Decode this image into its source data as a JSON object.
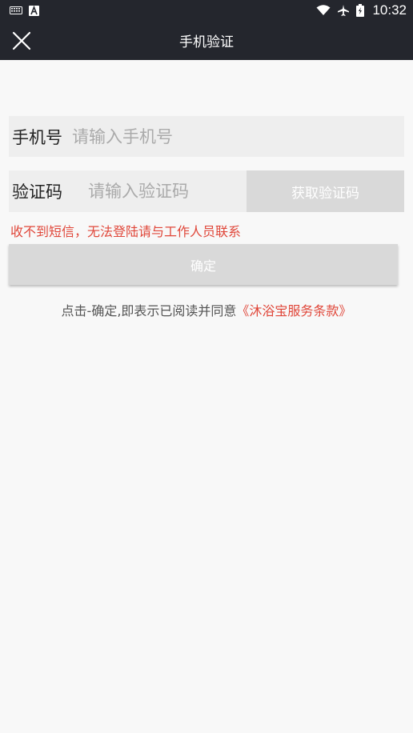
{
  "status_bar": {
    "time": "10:32",
    "left_icons": [
      "keyboard-icon",
      "a-badge-icon"
    ],
    "right_icons": [
      "wifi-icon",
      "airplane-icon",
      "battery-icon"
    ]
  },
  "header": {
    "title": "手机验证",
    "close_icon": "close-icon"
  },
  "form": {
    "phone_label": "手机号",
    "phone_placeholder": "请输入手机号",
    "phone_value": "",
    "code_label": "验证码",
    "code_placeholder": "请输入验证码",
    "code_value": "",
    "get_code_label": "获取验证码",
    "warning_text": "收不到短信，无法登陆请与工作人员联系",
    "confirm_label": "确定",
    "terms_prefix": "点击-确定,即表示已阅读并同意",
    "terms_link": "《沐浴宝服务条款》"
  },
  "colors": {
    "header_bg": "#24262d",
    "page_bg": "#f8f8f8",
    "input_row_bg": "#eeeeee",
    "button_disabled_bg": "#d9d9d9",
    "accent_red": "#e0473a"
  }
}
